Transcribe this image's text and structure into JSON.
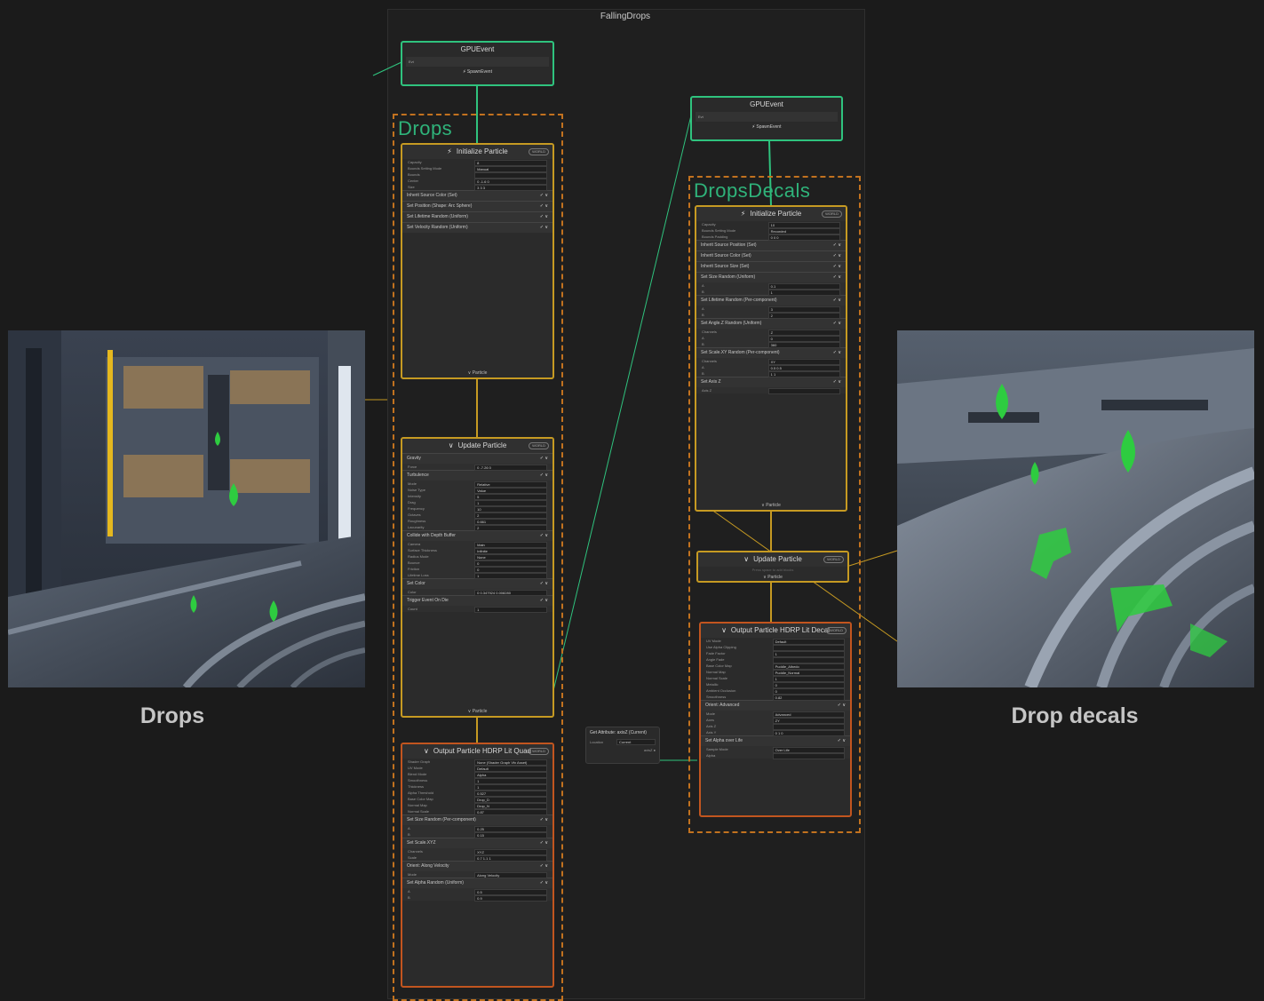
{
  "graph": {
    "title": "FallingDrops"
  },
  "captions": {
    "left": "Drops",
    "right": "Drop decals"
  },
  "left_image": {
    "name": "drops-scene",
    "drop_color": "#2ecc40"
  },
  "right_image": {
    "name": "drop-decals-scene",
    "drop_color": "#2ecc40"
  },
  "colors": {
    "accent_green": "#2fc37e",
    "accent_orange": "#c69a22",
    "accent_red": "#c2551f",
    "wire_orange": "#c69a22",
    "wire_green": "#2fc37e"
  },
  "icons": {
    "spawn": "lightning-icon",
    "update": "chevron-down-icon"
  },
  "drops_system": {
    "label": "Drops",
    "gpu_event": {
      "title": "GPUEvent",
      "port": "Evt",
      "spawn_label": "SpawnEvent"
    },
    "initialize": {
      "title": "Initialize Particle",
      "badge": "WORLD",
      "rows": [
        {
          "label": "Capacity",
          "value": "8"
        },
        {
          "label": "Bounds Setting Mode",
          "value": "Manual"
        },
        {
          "label": "Bounds",
          "value": ""
        },
        {
          "label": "Center",
          "value": "0   -1.6   0"
        },
        {
          "label": "Size",
          "value": "3   3   3"
        }
      ],
      "blocks": [
        "Inherit Source Color (Set)",
        "Set Position (Shape: Arc Sphere)",
        "Set Lifetime Random (Uniform)",
        "Set Velocity Random (Uniform)"
      ],
      "footer": "Particle"
    },
    "update": {
      "title": "Update Particle",
      "badge": "WORLD",
      "blocks": [
        {
          "title": "Gravity",
          "rows": [
            {
              "label": "Force",
              "value": "0   -7.26   0"
            }
          ]
        },
        {
          "title": "Turbulence",
          "rows": [
            {
              "label": "Mode",
              "value": "Relative"
            },
            {
              "label": "Noise Type",
              "value": "Value"
            },
            {
              "label": "Intensity",
              "value": "5"
            },
            {
              "label": "Drag",
              "value": "1"
            },
            {
              "label": "Frequency",
              "value": "10"
            },
            {
              "label": "Octaves",
              "value": "2"
            },
            {
              "label": "Roughness",
              "value": "0.661"
            },
            {
              "label": "Lacunarity",
              "value": "2"
            }
          ]
        },
        {
          "title": "Collide with Depth Buffer",
          "rows": [
            {
              "label": "Camera",
              "value": "Main"
            },
            {
              "label": "Surface Thickness",
              "value": "Infinite"
            },
            {
              "label": "Radius Mode",
              "value": "None"
            },
            {
              "label": "Bounce",
              "value": "0"
            },
            {
              "label": "Friction",
              "value": "0"
            },
            {
              "label": "Lifetime Loss",
              "value": "1"
            }
          ]
        },
        {
          "title": "Set Color",
          "rows": [
            {
              "label": "Color",
              "value": "0   0.347924   0.008280"
            }
          ]
        },
        {
          "title": "Trigger Event On Die",
          "rows": [
            {
              "label": "Count",
              "value": "1"
            }
          ]
        }
      ],
      "footer": "Particle"
    },
    "output": {
      "title": "Output Particle HDRP Lit Quad",
      "badge": "WORLD",
      "rows": [
        {
          "label": "Shader Graph",
          "value": "None (Shader Graph Vfx Asset)"
        },
        {
          "label": "UV Mode",
          "value": "Default"
        },
        {
          "label": "Blend Mode",
          "value": "Alpha"
        },
        {
          "label": "Smoothness",
          "value": "1"
        },
        {
          "label": "Thickness",
          "value": "1"
        },
        {
          "label": "Alpha Threshold",
          "value": "0.527"
        },
        {
          "label": "Base Color Map",
          "value": "Drop_D"
        },
        {
          "label": "Normal Map",
          "value": "Drop_N"
        },
        {
          "label": "Normal Scale",
          "value": "0.87"
        }
      ],
      "blocks": [
        {
          "title": "Set Size Random (Per-component)",
          "rows": [
            {
              "label": "A",
              "value": "0.25"
            },
            {
              "label": "B",
              "value": "0.15"
            }
          ]
        },
        {
          "title": "Set Scale.XYZ",
          "rows": [
            {
              "label": "Channels",
              "value": "XYZ"
            },
            {
              "label": "Scale",
              "value": "0.7   1.1   1"
            }
          ]
        },
        {
          "title": "Orient: Along Velocity",
          "rows": [
            {
              "label": "Mode",
              "value": "Along Velocity"
            }
          ]
        },
        {
          "title": "Set Alpha Random (Uniform)",
          "rows": [
            {
              "label": "A",
              "value": "0.5"
            },
            {
              "label": "B",
              "value": "0.9"
            }
          ]
        }
      ]
    }
  },
  "decals_system": {
    "label": "DropsDecals",
    "gpu_event": {
      "title": "GPUEvent",
      "port": "Evt",
      "spawn_label": "SpawnEvent"
    },
    "initialize": {
      "title": "Initialize Particle",
      "badge": "WORLD",
      "rows": [
        {
          "label": "Capacity",
          "value": "10"
        },
        {
          "label": "Bounds Setting Mode",
          "value": "Recorded"
        },
        {
          "label": "Bounds Padding",
          "value": "0   0   0"
        }
      ],
      "blocks": [
        {
          "title": "Inherit Source Position (Set)",
          "rows": []
        },
        {
          "title": "Inherit Source Color (Set)",
          "rows": []
        },
        {
          "title": "Inherit Source Size (Set)",
          "rows": []
        },
        {
          "title": "Set Size Random (Uniform)",
          "rows": [
            {
              "label": "A",
              "value": "0.1"
            },
            {
              "label": "B",
              "value": "1"
            }
          ]
        },
        {
          "title": "Set Lifetime Random (Per-component)",
          "rows": [
            {
              "label": "A",
              "value": "3"
            },
            {
              "label": "B",
              "value": "2"
            }
          ]
        },
        {
          "title": "Set Angle.Z Random (Uniform)",
          "rows": [
            {
              "label": "Channels",
              "value": "Z"
            },
            {
              "label": "A",
              "value": "0"
            },
            {
              "label": "B",
              "value": "360"
            }
          ]
        },
        {
          "title": "Set Scale.XY Random (Per-component)",
          "rows": [
            {
              "label": "Channels",
              "value": "XY"
            },
            {
              "label": "A",
              "value": "0.5   0.5"
            },
            {
              "label": "B",
              "value": "1   1"
            }
          ]
        },
        {
          "title": "Set Axis Z",
          "rows": [
            {
              "label": "Axis Z",
              "value": ""
            }
          ]
        }
      ],
      "footer": "Particle"
    },
    "update": {
      "title": "Update Particle",
      "badge": "WORLD",
      "hint": "Press space to add blocks",
      "footer": "Particle"
    },
    "output": {
      "title": "Output Particle HDRP Lit Decal",
      "badge": "WORLD",
      "rows": [
        {
          "label": "UV Mode",
          "value": "Default"
        },
        {
          "label": "Use Alpha Clipping",
          "value": ""
        },
        {
          "label": "Fade Factor",
          "value": "1"
        },
        {
          "label": "Angle Fade",
          "value": ""
        },
        {
          "label": "Base Color Map",
          "value": "Puddle_Albedo"
        },
        {
          "label": "Normal Map",
          "value": "Puddle_Normal"
        },
        {
          "label": "Normal Scale",
          "value": "1"
        },
        {
          "label": "Metallic",
          "value": "0"
        },
        {
          "label": "Ambient Occlusion",
          "value": "0"
        },
        {
          "label": "Smoothness",
          "value": "0.82"
        }
      ],
      "blocks": [
        {
          "title": "Orient: Advanced",
          "rows": [
            {
              "label": "Mode",
              "value": "Advanced"
            },
            {
              "label": "Axes",
              "value": "ZY"
            },
            {
              "label": "Axis Z",
              "value": ""
            },
            {
              "label": "Axis Y",
              "value": "0   1   0"
            }
          ]
        },
        {
          "title": "Set Alpha over Life",
          "rows": [
            {
              "label": "Sample Mode",
              "value": "Over Life"
            },
            {
              "label": "Alpha",
              "value": ""
            }
          ]
        }
      ]
    }
  },
  "attribute_node": {
    "title": "Get Attribute: axisZ (Current)",
    "location_label": "Location",
    "location_value": "Current",
    "out_label": "axisZ"
  }
}
